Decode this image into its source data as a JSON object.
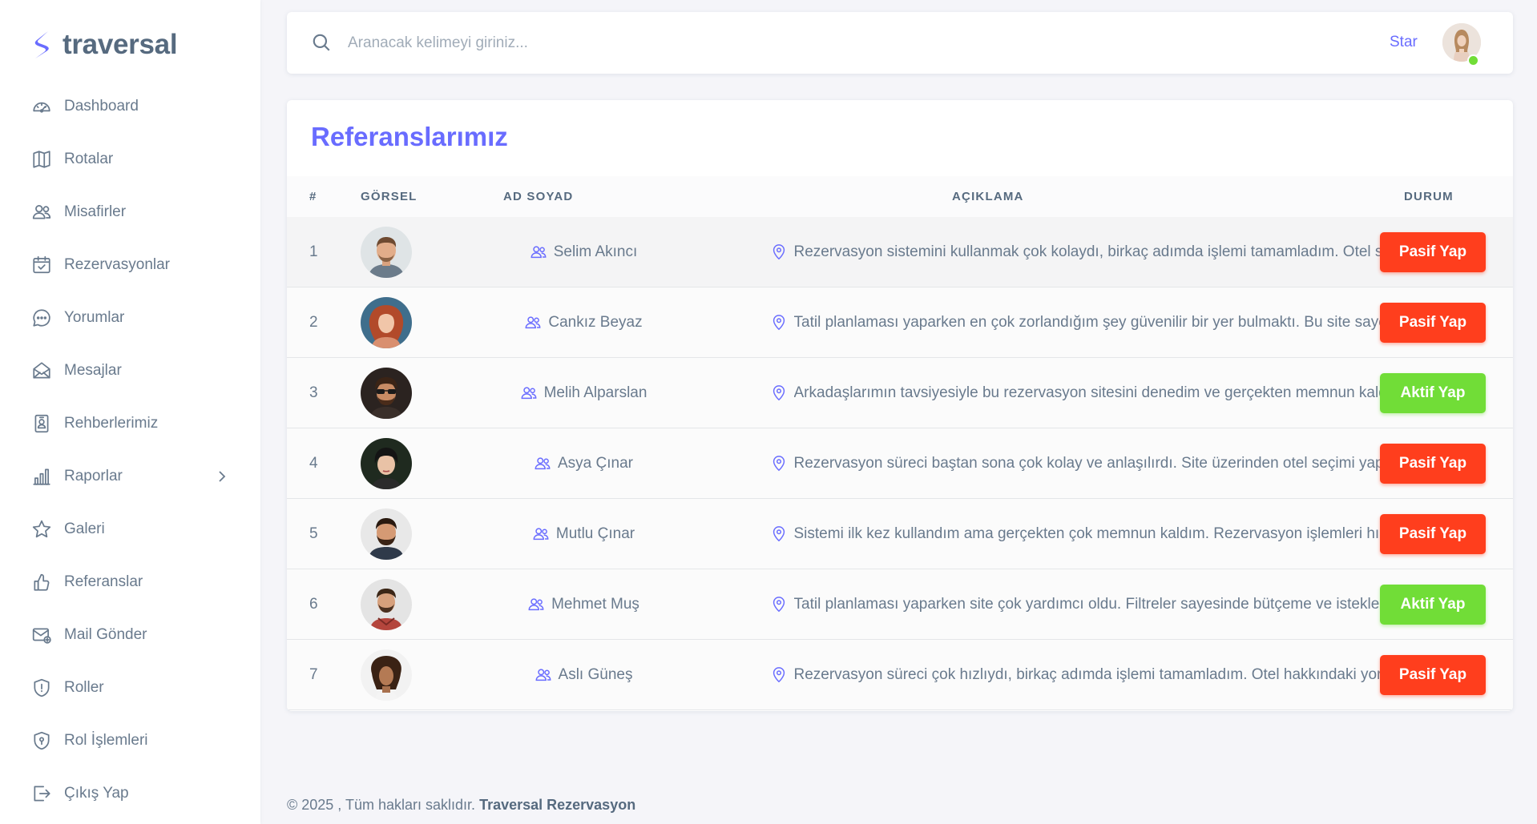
{
  "brand": {
    "name": "traversal"
  },
  "colors": {
    "primary": "#696cff",
    "danger": "#ff3e1d",
    "success": "#71dd37",
    "text": "#697a8d"
  },
  "sidebar": {
    "items": [
      {
        "label": "Dashboard",
        "icon": "dashboard-icon"
      },
      {
        "label": "Rotalar",
        "icon": "map-icon"
      },
      {
        "label": "Misafirler",
        "icon": "users-icon"
      },
      {
        "label": "Rezervasyonlar",
        "icon": "calendar-check-icon"
      },
      {
        "label": "Yorumlar",
        "icon": "chat-icon"
      },
      {
        "label": "Mesajlar",
        "icon": "envelope-open-icon"
      },
      {
        "label": "Rehberlerimiz",
        "icon": "id-card-icon"
      },
      {
        "label": "Raporlar",
        "icon": "bar-chart-icon",
        "has_submenu": true
      },
      {
        "label": "Galeri",
        "icon": "star-icon"
      },
      {
        "label": "Referanslar",
        "icon": "thumbs-up-icon"
      },
      {
        "label": "Mail Gönder",
        "icon": "mail-plus-icon"
      },
      {
        "label": "Roller",
        "icon": "shield-icon"
      },
      {
        "label": "Rol İşlemleri",
        "icon": "shield-lock-icon"
      },
      {
        "label": "Çıkış Yap",
        "icon": "logout-icon"
      }
    ]
  },
  "navbar": {
    "search_placeholder": "Aranacak kelimeyi giriniz...",
    "star_label": "Star"
  },
  "card": {
    "title": "Referanslarımız",
    "columns": [
      "#",
      "GÖRSEL",
      "AD SOYAD",
      "AÇIKLAMA",
      "DURUM"
    ],
    "rows": [
      {
        "num": "1",
        "name": "Selim Akıncı",
        "description": "Rezervasyon sistemini kullanmak çok kolaydı, birkaç adımda işlemi tamamladım. Otel seçenekleri oldukça fazla",
        "status_label": "Pasif Yap",
        "status": "pasif"
      },
      {
        "num": "2",
        "name": "Cankız Beyaz",
        "description": "Tatil planlaması yaparken en çok zorlandığım şey güvenilir bir yer bulmaktı. Bu site sayesinde kolayca buldum",
        "status_label": "Pasif Yap",
        "status": "pasif"
      },
      {
        "num": "3",
        "name": "Melih Alparslan",
        "description": "Arkadaşlarımın tavsiyesiyle bu rezervasyon sitesini denedim ve gerçekten memnun kaldım",
        "status_label": "Aktif Yap",
        "status": "aktif"
      },
      {
        "num": "4",
        "name": "Asya Çınar",
        "description": "Rezervasyon süreci baştan sona çok kolay ve anlaşılırdı. Site üzerinden otel seçimi yapmak keyifliydi",
        "status_label": "Pasif Yap",
        "status": "pasif"
      },
      {
        "num": "5",
        "name": "Mutlu Çınar",
        "description": "Sistemi ilk kez kullandım ama gerçekten çok memnun kaldım. Rezervasyon işlemleri hızlı ve sorunsuzdu",
        "status_label": "Pasif Yap",
        "status": "pasif"
      },
      {
        "num": "6",
        "name": "Mehmet Muş",
        "description": "Tatil planlaması yaparken site çok yardımcı oldu. Filtreler sayesinde bütçeme ve isteklerime uygun otel buldum",
        "status_label": "Aktif Yap",
        "status": "aktif"
      },
      {
        "num": "7",
        "name": "Aslı Güneş",
        "description": "Rezervasyon süreci çok hızlıydı, birkaç adımda işlemi tamamladım. Otel hakkındaki yorumlar çok faydalıydı",
        "status_label": "Pasif Yap",
        "status": "pasif"
      }
    ]
  },
  "footer": {
    "text": "© 2025 , Tüm hakları saklıdır.",
    "brand": "Traversal Rezervasyon"
  }
}
